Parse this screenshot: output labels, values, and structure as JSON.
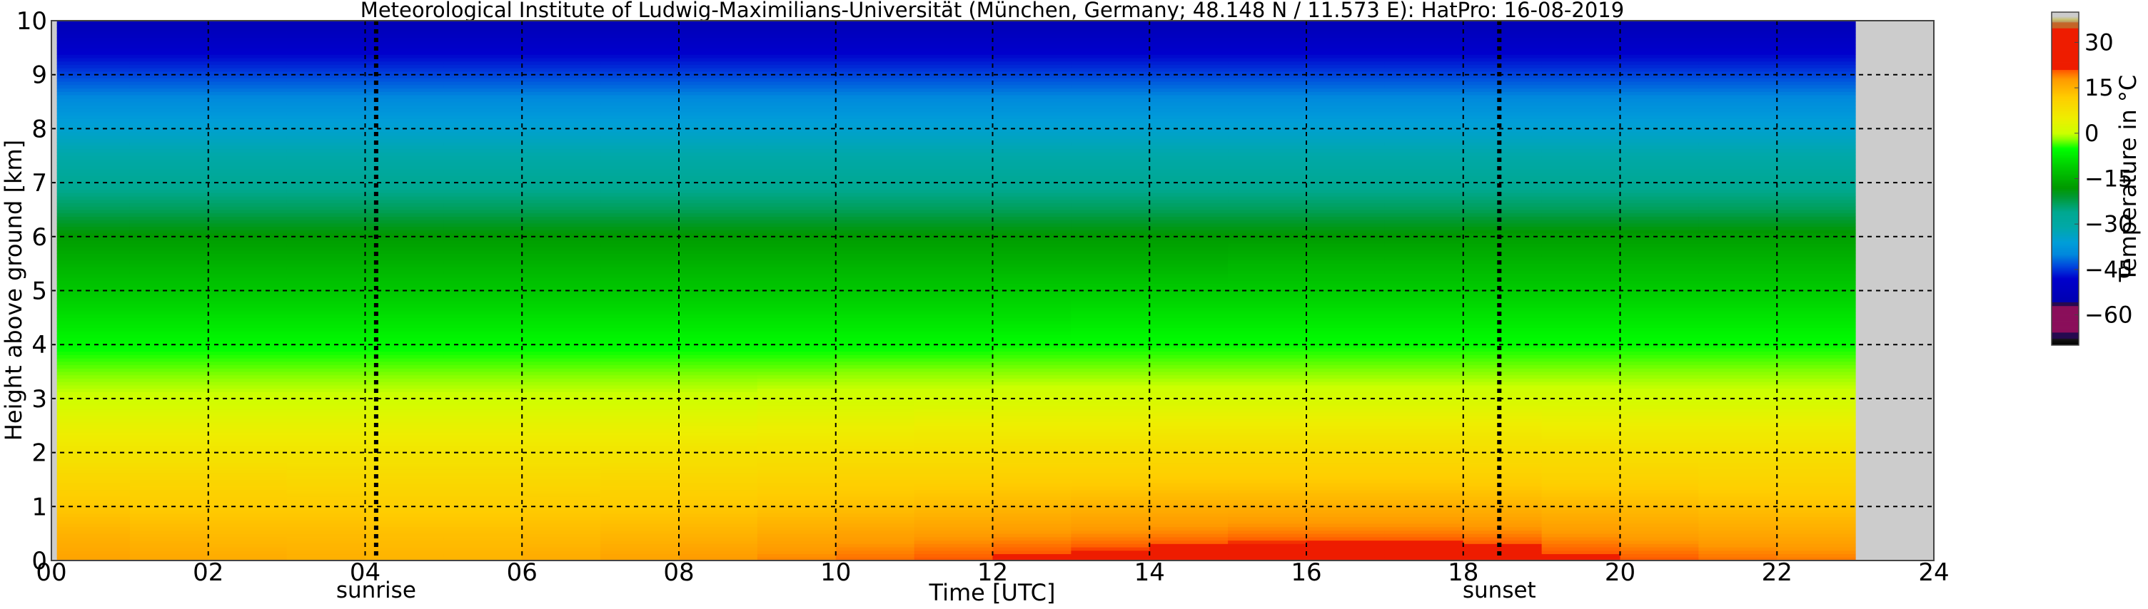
{
  "chart_data": {
    "type": "heatmap",
    "title": "Meteorological Institute of Ludwig-Maximilians-Universität (München, Germany; 48.148 N / 11.573 E):    HatPro: 16-08-2019",
    "xlabel": "Time [UTC]",
    "ylabel": "Height above ground [km]",
    "xlim": [
      0,
      24
    ],
    "ylim": [
      0,
      10
    ],
    "xticks": [
      "00",
      "02",
      "04",
      "06",
      "08",
      "10",
      "12",
      "14",
      "16",
      "18",
      "20",
      "22",
      "24"
    ],
    "yticks": [
      "0",
      "1",
      "2",
      "3",
      "4",
      "5",
      "6",
      "7",
      "8",
      "9",
      "10"
    ],
    "grid": true,
    "no_data_color": "#cccccc",
    "data_time_range_h": [
      0.07,
      23.0
    ],
    "events": [
      {
        "label": "sunrise",
        "time_h": 4.14
      },
      {
        "label": "sunset",
        "time_h": 18.46
      }
    ],
    "times_h": [
      0,
      1,
      2,
      3,
      4,
      5,
      6,
      7,
      8,
      9,
      10,
      11,
      12,
      13,
      14,
      15,
      16,
      17,
      18,
      19,
      20,
      21,
      22
    ],
    "heights_km": [
      0,
      0.5,
      1,
      1.5,
      2,
      2.5,
      3,
      3.5,
      4,
      4.5,
      5,
      5.5,
      6,
      6.5,
      7,
      7.5,
      8,
      8.5,
      9,
      9.5,
      10
    ],
    "temperature_c": [
      [
        17,
        16.5,
        16,
        15.5,
        15,
        15,
        16,
        17,
        18,
        19,
        20,
        21,
        22,
        23,
        24,
        24.5,
        25,
        25,
        24,
        22,
        21,
        20,
        19.5
      ],
      [
        15,
        14.5,
        14,
        14,
        13.5,
        13.5,
        14,
        14.5,
        15,
        16,
        17,
        17.5,
        18,
        18.5,
        19,
        19.5,
        19.5,
        19.5,
        19,
        18,
        17,
        16.5,
        16
      ],
      [
        12.5,
        12,
        12,
        12,
        11.5,
        11.5,
        12,
        12,
        12.5,
        13,
        13.5,
        14,
        14.5,
        15,
        15.5,
        15.5,
        15.5,
        15.5,
        15,
        14.5,
        14,
        13.5,
        13
      ],
      [
        10,
        10,
        10,
        9.5,
        9.5,
        9.5,
        9.5,
        10,
        10,
        10.5,
        11,
        11,
        11.5,
        11.5,
        12,
        12,
        12,
        12,
        11.5,
        11,
        11,
        10.5,
        10.5
      ],
      [
        7,
        7,
        7,
        7,
        7,
        7,
        7,
        7,
        7.5,
        7.5,
        8,
        8,
        8.5,
        8.5,
        9,
        9,
        9,
        9,
        8.5,
        8.5,
        8,
        8,
        8
      ],
      [
        4,
        4,
        4,
        4,
        4,
        4,
        4,
        4,
        4,
        4.5,
        4.5,
        5,
        5,
        5,
        5.5,
        5.5,
        5.5,
        5.5,
        5.5,
        5,
        5,
        5,
        5
      ],
      [
        0.5,
        0.5,
        0.5,
        0.5,
        0.5,
        0.5,
        0.5,
        0.5,
        0.5,
        1,
        1,
        1,
        1.5,
        1.5,
        1.5,
        1.5,
        1.5,
        1.5,
        1.5,
        1.5,
        1,
        1,
        1
      ],
      [
        -2.5,
        -2.5,
        -2.5,
        -2.5,
        -2.5,
        -2.5,
        -2.5,
        -2.5,
        -2.5,
        -2.5,
        -2,
        -2,
        -2,
        -2,
        -2,
        -2,
        -2,
        -2,
        -2,
        -2,
        -2,
        -2,
        -2
      ],
      [
        -5.5,
        -5.5,
        -5.5,
        -5.5,
        -5.5,
        -5.5,
        -5.5,
        -5.5,
        -5.5,
        -5.5,
        -5.5,
        -5.5,
        -5,
        -5,
        -5,
        -5,
        -5,
        -5,
        -5,
        -5,
        -5,
        -5,
        -5
      ],
      [
        -8.5,
        -8.5,
        -8.5,
        -8.5,
        -8.5,
        -8.5,
        -8.5,
        -8.5,
        -8.5,
        -8.5,
        -8.5,
        -8.5,
        -8.5,
        -8,
        -8,
        -8,
        -8,
        -8,
        -8,
        -8,
        -8,
        -8,
        -8
      ],
      [
        -11.5,
        -11.5,
        -11.5,
        -11.5,
        -11.5,
        -11.5,
        -11.5,
        -11.5,
        -11.5,
        -11.5,
        -11.5,
        -11.5,
        -11,
        -11,
        -11,
        -11,
        -11,
        -11,
        -11,
        -11,
        -11,
        -11,
        -11
      ],
      [
        -14.5,
        -14.5,
        -14.5,
        -14.5,
        -14.5,
        -14.5,
        -14.5,
        -14.5,
        -14.5,
        -14.5,
        -14.5,
        -14.5,
        -14.5,
        -14.5,
        -14.5,
        -14,
        -14,
        -14,
        -14,
        -14,
        -14,
        -14,
        -14
      ],
      [
        -17.5,
        -17.5,
        -17.5,
        -17.5,
        -17.5,
        -17.5,
        -17.5,
        -17.5,
        -17.5,
        -17.5,
        -17.5,
        -17.5,
        -17.5,
        -17.5,
        -17.5,
        -17.5,
        -17.5,
        -17.5,
        -17,
        -17,
        -17,
        -17,
        -17
      ],
      [
        -23,
        -23,
        -23,
        -23,
        -23,
        -23,
        -23,
        -23,
        -23,
        -23,
        -23,
        -23,
        -23,
        -23,
        -23,
        -23,
        -23,
        -23,
        -23,
        -23,
        -23,
        -23,
        -23
      ],
      [
        -27,
        -27,
        -27,
        -27,
        -27,
        -27,
        -27,
        -27,
        -27,
        -27,
        -27,
        -27,
        -27,
        -27,
        -27,
        -27,
        -27,
        -27,
        -27,
        -27,
        -27,
        -27,
        -27
      ],
      [
        -31,
        -31,
        -31,
        -31,
        -31,
        -31,
        -31,
        -31,
        -31,
        -31,
        -31,
        -31,
        -31,
        -31,
        -31,
        -31,
        -31,
        -31,
        -31,
        -31,
        -31,
        -31,
        -31
      ],
      [
        -35,
        -35,
        -35,
        -35,
        -35,
        -35,
        -35,
        -35,
        -35,
        -35,
        -35,
        -35,
        -35,
        -35,
        -35,
        -35,
        -35,
        -35,
        -35,
        -35,
        -35,
        -35,
        -35
      ],
      [
        -39,
        -39,
        -39,
        -39,
        -39,
        -39,
        -39,
        -39,
        -39,
        -39,
        -39,
        -39,
        -39,
        -39,
        -39,
        -39,
        -39,
        -39,
        -39,
        -39,
        -39,
        -39,
        -39
      ],
      [
        -44,
        -44,
        -44,
        -44,
        -44,
        -44,
        -44,
        -44,
        -44,
        -44,
        -44,
        -44,
        -44,
        -44,
        -44,
        -44,
        -44,
        -44,
        -44,
        -44,
        -44,
        -44,
        -44
      ],
      [
        -49,
        -49,
        -49,
        -49,
        -49,
        -49,
        -49,
        -49,
        -49,
        -49,
        -49,
        -49,
        -49,
        -49,
        -49,
        -49,
        -49,
        -49,
        -49,
        -49,
        -49,
        -49,
        -49
      ],
      [
        -54,
        -54,
        -54,
        -54,
        -54,
        -54,
        -54,
        -54,
        -54,
        -54,
        -54,
        -54,
        -54,
        -54,
        -54,
        -54,
        -54,
        -54,
        -54,
        -54,
        -54,
        -54,
        -54
      ]
    ],
    "colorbar": {
      "label": "Temperature in °C",
      "range": [
        -70,
        40
      ],
      "ticks": [
        "30",
        "15",
        "0",
        "−15",
        "−30",
        "−45",
        "−60"
      ],
      "tick_values": [
        30,
        15,
        0,
        -15,
        -30,
        -45,
        -60
      ],
      "stops": [
        [
          -70,
          "#000000"
        ],
        [
          -67.9,
          "#151515"
        ],
        [
          -67.8,
          "#260a50"
        ],
        [
          -65.8,
          "#260a50"
        ],
        [
          -65.7,
          "#8a0f5a"
        ],
        [
          -57.1,
          "#8a0f5a"
        ],
        [
          -57,
          "#260a50"
        ],
        [
          -55.8,
          "#260a50"
        ],
        [
          -55.7,
          "#0000b0"
        ],
        [
          -48,
          "#0000cc"
        ],
        [
          -44,
          "#0044dd"
        ],
        [
          -40,
          "#0088dd"
        ],
        [
          -36,
          "#009ed8"
        ],
        [
          -31,
          "#00a8a8"
        ],
        [
          -26,
          "#00a890"
        ],
        [
          -21,
          "#009933"
        ],
        [
          -18,
          "#009900"
        ],
        [
          -11,
          "#00cc00"
        ],
        [
          -5,
          "#00ff00"
        ],
        [
          -2,
          "#88ff00"
        ],
        [
          0,
          "#ccff00"
        ],
        [
          5,
          "#eeee00"
        ],
        [
          12,
          "#ffcc00"
        ],
        [
          18,
          "#ff9900"
        ],
        [
          21,
          "#ff5500"
        ],
        [
          21.1,
          "#ee1c00"
        ],
        [
          34.7,
          "#ee1c00"
        ],
        [
          34.8,
          "#c46428"
        ],
        [
          36.6,
          "#c46428"
        ],
        [
          36.7,
          "#b89060"
        ],
        [
          37.6,
          "#c8c070"
        ],
        [
          38.7,
          "#cccccc"
        ],
        [
          40,
          "#cccccc"
        ]
      ]
    }
  }
}
